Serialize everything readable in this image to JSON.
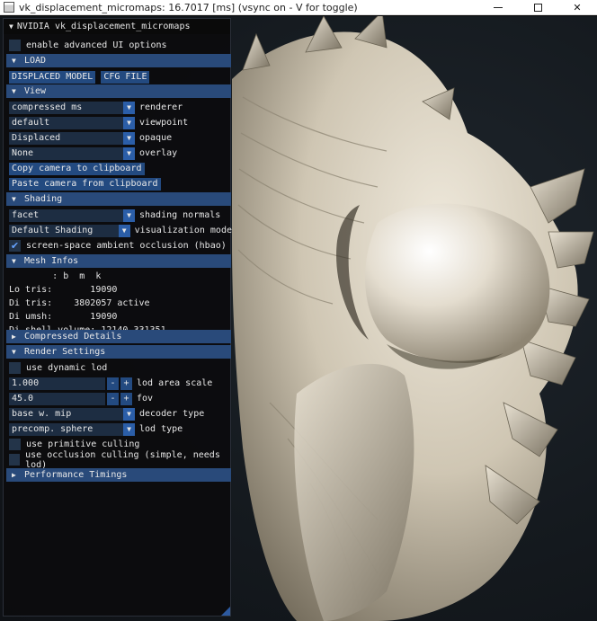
{
  "window": {
    "title": "vk_displacement_micromaps: 16.7017 [ms] (vsync on - V for toggle)",
    "min_label": "—",
    "close_label": "✕"
  },
  "panel": {
    "title": "NVIDIA vk_displacement_micromaps",
    "advanced_ui": "enable advanced UI options",
    "load": {
      "header": "LOAD",
      "displaced_model": "DISPLACED MODEL",
      "cfg_file": "CFG FILE"
    },
    "view": {
      "header": "View",
      "renderer_value": "compressed ms",
      "renderer_label": "renderer",
      "viewpoint_value": "default",
      "viewpoint_label": "viewpoint",
      "opaque_value": "Displaced",
      "opaque_label": "opaque",
      "overlay_value": "None",
      "overlay_label": "overlay",
      "copy_camera": "Copy camera to clipboard",
      "paste_camera": "Paste camera from clipboard"
    },
    "shading": {
      "header": "Shading",
      "normals_value": "facet",
      "normals_label": "shading normals",
      "vis_value": "Default Shading",
      "vis_label": "visualization mode",
      "ao_label": "screen-space ambient occlusion (hbao)",
      "ao_checked": true
    },
    "mesh_infos": {
      "header": "Mesh Infos",
      "units_line": "        : b  m  k",
      "lo_tris": "Lo tris:       19090",
      "di_tris": "Di tris:    3802057 active",
      "di_umsh": "Di umsh:       19090",
      "di_shell": "Di shell volume: 12140.331351"
    },
    "compressed_details": {
      "header": "Compressed Details"
    },
    "render_settings": {
      "header": "Render Settings",
      "dynamic_lod": "use dynamic lod",
      "lod_area_value": "1.000",
      "lod_area_label": "lod area scale",
      "fov_value": "45.0",
      "fov_label": "fov",
      "minus": "-",
      "plus": "+",
      "decoder_value": "base w. mip",
      "decoder_label": "decoder type",
      "lod_type_value": "precomp. sphere",
      "lod_type_label": "lod type",
      "prim_culling": "use primitive culling",
      "occ_culling": "use occlusion culling (simple, needs lod)"
    },
    "performance": {
      "header": "Performance Timings"
    }
  },
  "colors": {
    "header": "#294a7a",
    "button": "#234a80",
    "frame_bg": "#1d2d42",
    "checkmark": "#66a3ff"
  },
  "icons": {
    "expanded": "triangle-down",
    "collapsed": "triangle-right",
    "dropdown": "triangle-down"
  }
}
